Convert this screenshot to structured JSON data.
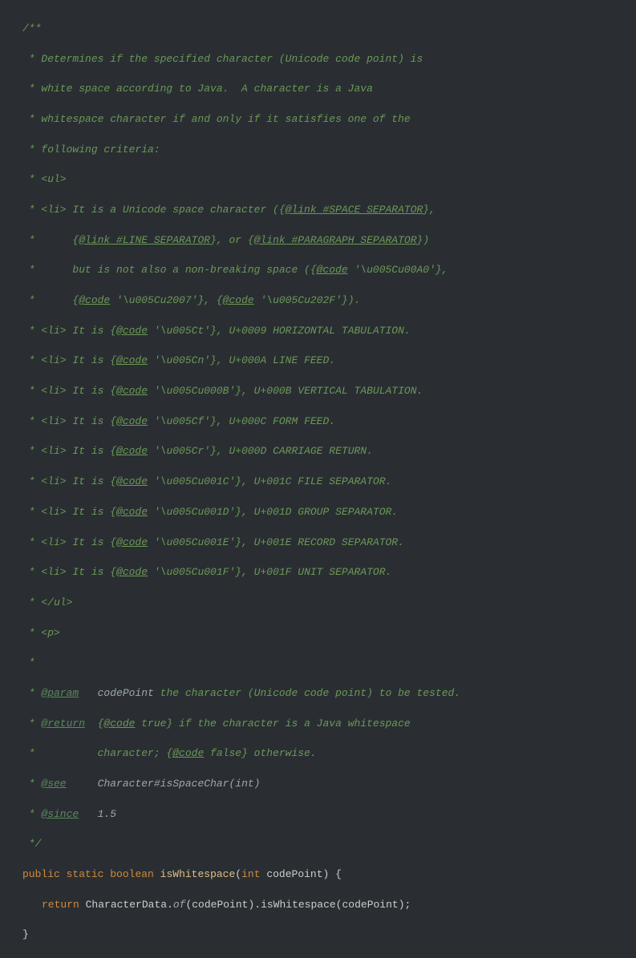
{
  "javadoc": {
    "open": "/**",
    "line1": " * Determines if the specified character (Unicode code point) is",
    "line2": " * white space according to Java.  A character is a Java",
    "line3": " * whitespace character if and only if it satisfies one of the",
    "line4": " * following criteria:",
    "line5": " * <ul>",
    "line6a": " * <li> It is a Unicode space character ({",
    "link1": "@link",
    "line6b": " #SPACE_SEPARATOR",
    "line6c": "},",
    "line7a": " *      {",
    "line7b": " #LINE_SEPARATOR",
    "line7c": "}, or {",
    "line7d": " #PARAGRAPH_SEPARATOR",
    "line7e": "})",
    "line8a": " *      but is not also a non-breaking space ({",
    "code_tag": "@code",
    "line8b": " '\\u005Cu00A0'",
    "line8c": "},",
    "line9a": " *      {",
    "line9b": " '\\u005Cu2007'",
    "line9c": "}, {",
    "line9d": " '\\u005Cu202F'",
    "line9e": "}).",
    "line10a": " * <li> It is {",
    "line10b": " '\\u005Ct'",
    "line10c": "}, U+0009 HORIZONTAL TABULATION.",
    "line11b": " '\\u005Cn'",
    "line11c": "}, U+000A LINE FEED.",
    "line12b": " '\\u005Cu000B'",
    "line12c": "}, U+000B VERTICAL TABULATION.",
    "line13b": " '\\u005Cf'",
    "line13c": "}, U+000C FORM FEED.",
    "line14b": " '\\u005Cr'",
    "line14c": "}, U+000D CARRIAGE RETURN.",
    "line15b": " '\\u005Cu001C'",
    "line15c": "}, U+001C FILE SEPARATOR.",
    "line16b": " '\\u005Cu001D'",
    "line16c": "}, U+001D GROUP SEPARATOR.",
    "line17b": " '\\u005Cu001E'",
    "line17c": "}, U+001E RECORD SEPARATOR.",
    "line18b": " '\\u005Cu001F'",
    "line18c": "}, U+001F UNIT SEPARATOR.",
    "line19": " * </ul>",
    "line20": " * <p>",
    "line21": " *",
    "param_tag": "@param",
    "param_name": "codePoint",
    "param_desc": " the character (Unicode code point) to be tested.",
    "return_tag": "@return",
    "return_a": "  {",
    "return_b": " true",
    "return_c": "} if the character is a Java whitespace",
    "return_d": " *          character; {",
    "return_e": " false",
    "return_f": "} otherwise.",
    "see_tag": "@see",
    "see_val": "Character#isSpaceChar(int)",
    "since_tag": "@since",
    "since_val": "1.5",
    "close": " */"
  },
  "code": {
    "public": "public",
    "static": "static",
    "boolean": "boolean",
    "method": "isWhitespace",
    "int": "int",
    "param": "codePoint",
    "return": "return",
    "expr1": "CharacterData.",
    "of": "of",
    "expr2": "(codePoint).isWhitespace(codePoint)",
    "semi": ";",
    "brace_close": "}"
  }
}
